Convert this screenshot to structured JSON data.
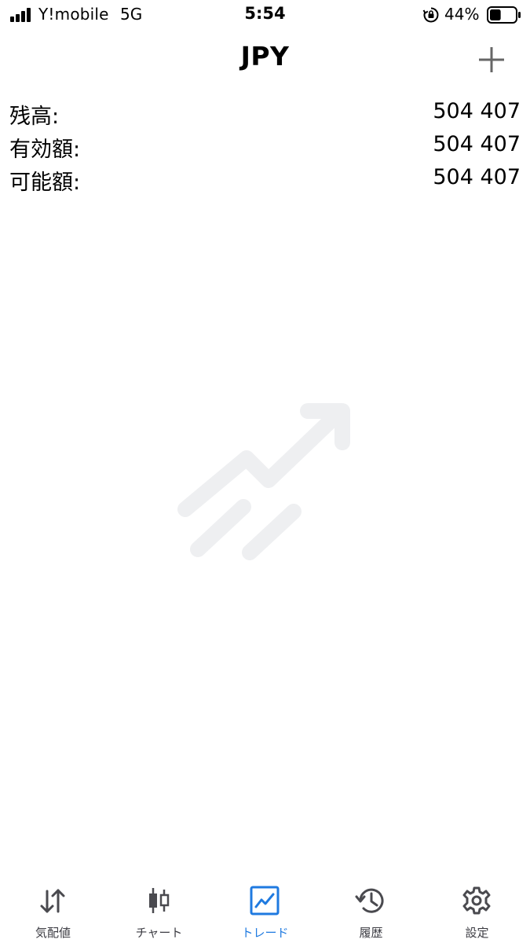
{
  "status_bar": {
    "carrier": "Y!mobile",
    "network": "5G",
    "time": "5:54",
    "battery_percent": "44%",
    "battery_level": 0.44
  },
  "header": {
    "title": "JPY",
    "add_icon": "plus-icon"
  },
  "balances": [
    {
      "label": "残高:",
      "value": "504 407"
    },
    {
      "label": "有効額:",
      "value": "504 407"
    },
    {
      "label": "可能額:",
      "value": "504 407"
    }
  ],
  "watermark_icon": "trending-up-icon",
  "tabs": [
    {
      "label": "気配値",
      "icon": "arrows-up-down-icon",
      "active": false
    },
    {
      "label": "チャート",
      "icon": "candlestick-icon",
      "active": false
    },
    {
      "label": "トレード",
      "icon": "trade-chart-icon",
      "active": true
    },
    {
      "label": "履歴",
      "icon": "history-icon",
      "active": false
    },
    {
      "label": "設定",
      "icon": "gear-icon",
      "active": false
    }
  ],
  "colors": {
    "accent": "#1f7ae0",
    "tab_inactive": "#3c3c43",
    "watermark": "#eeeff1",
    "text": "#000000"
  }
}
